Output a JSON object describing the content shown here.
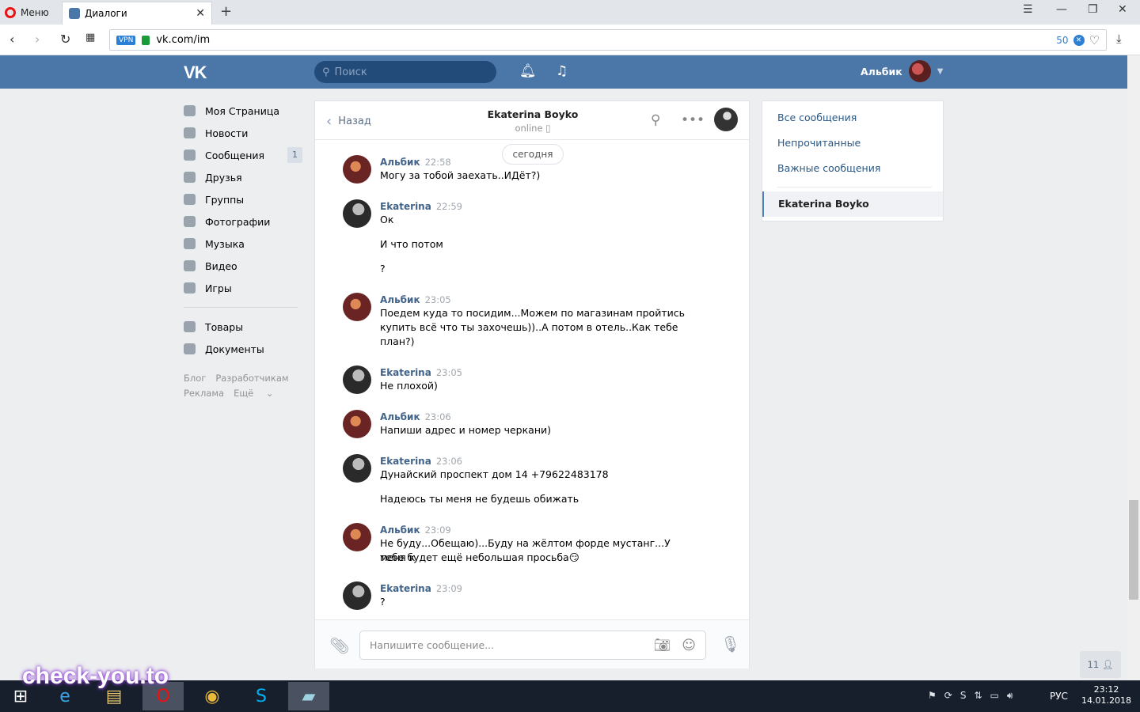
{
  "browser": {
    "menu_label": "Меню",
    "tab_title": "Диалоги",
    "url": "vk.com/im",
    "vpn_label": "VPN",
    "blocked_count": "50"
  },
  "header": {
    "search_placeholder": "Поиск",
    "user_name": "Альбик"
  },
  "left_menu": {
    "items": [
      {
        "label": "Моя Страница",
        "icon": "home-icon"
      },
      {
        "label": "Новости",
        "icon": "news-icon"
      },
      {
        "label": "Сообщения",
        "icon": "messages-icon",
        "badge": "1"
      },
      {
        "label": "Друзья",
        "icon": "friends-icon"
      },
      {
        "label": "Группы",
        "icon": "groups-icon"
      },
      {
        "label": "Фотографии",
        "icon": "photos-icon"
      },
      {
        "label": "Музыка",
        "icon": "music-icon"
      },
      {
        "label": "Видео",
        "icon": "video-icon"
      },
      {
        "label": "Игры",
        "icon": "games-icon"
      }
    ],
    "items2": [
      {
        "label": "Товары",
        "icon": "goods-icon"
      },
      {
        "label": "Документы",
        "icon": "documents-icon"
      }
    ],
    "footer": [
      "Блог",
      "Разработчикам",
      "Реклама",
      "Ещё"
    ]
  },
  "chat": {
    "back_label": "Назад",
    "peer_name": "Ekaterina Boyko",
    "peer_status": "online",
    "date_separator": "сегодня",
    "messages": [
      {
        "author": "Альбик",
        "time": "22:58",
        "lines": [
          "Могу за тобой заехать..ИДёт?)"
        ]
      },
      {
        "author": "Ekaterina",
        "time": "22:59",
        "lines": [
          "Ок",
          "И что потом",
          "?"
        ]
      },
      {
        "author": "Альбик",
        "time": "23:05",
        "lines": [
          "Поедем куда то посидим...Можем по магазинам пройтись",
          "купить всё что ты захочешь))..А потом в отель..Как тебе",
          "план?)"
        ]
      },
      {
        "author": "Ekaterina",
        "time": "23:05",
        "lines": [
          "Не плохой)"
        ]
      },
      {
        "author": "Альбик",
        "time": "23:06",
        "lines": [
          "Напиши адрес и номер черкани)"
        ]
      },
      {
        "author": "Ekaterina",
        "time": "23:06",
        "lines": [
          "Дунайский проспект дом 14 +79622483178",
          "Надеюсь ты меня не будешь обижать"
        ]
      },
      {
        "author": "Альбик",
        "time": "23:09",
        "lines": [
          "Не буду...Обещаю)...Буду на жёлтом форде мустанг...У меня к",
          "тебе будет ещё небольшая просьба😏"
        ]
      },
      {
        "author": "Ekaterina",
        "time": "23:09",
        "lines": [
          "?"
        ]
      }
    ],
    "input_placeholder": "Напишите сообщение..."
  },
  "filters": {
    "all": "Все сообщения",
    "unread": "Непрочитанные",
    "important": "Важные сообщения",
    "active_dialog": "Ekaterina Boyko"
  },
  "friends_online": "11",
  "taskbar": {
    "lang": "РУС",
    "time": "23:12",
    "date": "14.01.2018"
  },
  "watermark": "check-you.to"
}
